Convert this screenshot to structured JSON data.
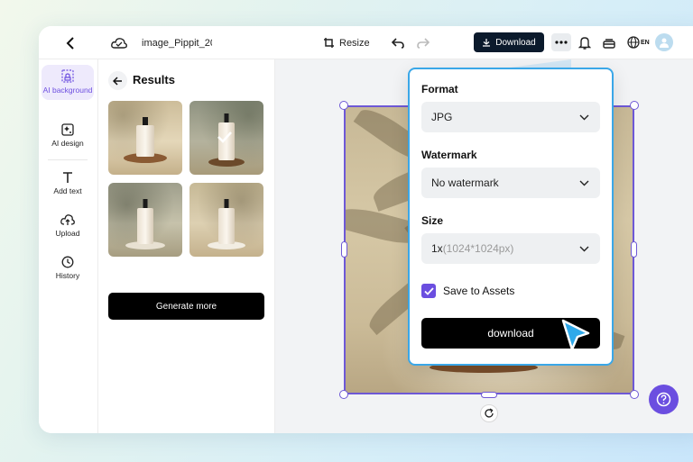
{
  "topbar": {
    "title": "image_Pippit_20",
    "resize_label": "Resize",
    "download_label": "Download",
    "lang_label": "EN"
  },
  "sidebar": {
    "items": [
      {
        "label": "AI background",
        "icon": "ai-background-icon",
        "active": true
      },
      {
        "label": "AI design",
        "icon": "ai-design-icon"
      },
      {
        "label": "Add text",
        "icon": "text-icon"
      },
      {
        "label": "Upload",
        "icon": "upload-icon"
      },
      {
        "label": "History",
        "icon": "clock-icon"
      }
    ]
  },
  "results": {
    "title": "Results",
    "generate_more_label": "Generate more"
  },
  "download_popup": {
    "format_label": "Format",
    "format_value": "JPG",
    "watermark_label": "Watermark",
    "watermark_value": "No watermark",
    "size_label": "Size",
    "size_value": "1x",
    "size_detail": "(1024*1024px)",
    "save_to_assets_label": "Save to Assets",
    "save_to_assets_checked": true,
    "download_label": "download"
  },
  "colors": {
    "accent": "#6b4ee0",
    "dark_button": "#0b1a2c",
    "popup_border": "#3aa7e8"
  }
}
